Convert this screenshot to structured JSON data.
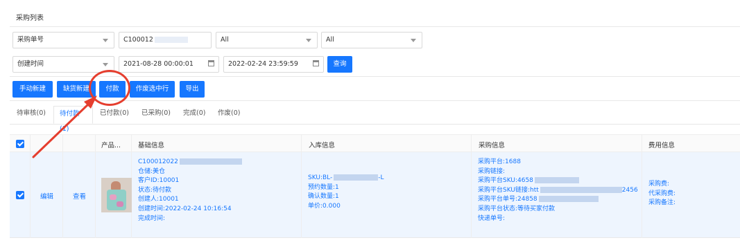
{
  "panel": {
    "title": "采购列表"
  },
  "filters": {
    "row1": {
      "field_select": "采购单号",
      "order_no_value": "C100012",
      "select2": "All",
      "select3": "All"
    },
    "row2": {
      "time_select": "创建时间",
      "start_time": "2021-08-28 00:00:01",
      "end_time": "2022-02-24 23:59:59",
      "query_button": "查询"
    }
  },
  "toolbar": {
    "buttons": [
      "手动新建",
      "缺货新建",
      "付款",
      "作废选中行",
      "导出"
    ]
  },
  "tabs": [
    "待审核(0)",
    "待付款(1)",
    "已付款(0)",
    "已采购(0)",
    "完成(0)",
    "作废(0)"
  ],
  "active_tab": 1,
  "table": {
    "headers": {
      "product": "产品...",
      "basic": "基础信息",
      "inbound": "入库信息",
      "purchase": "采购信息",
      "fee": "费用信息"
    },
    "row": {
      "actions": {
        "edit": "编辑",
        "view": "查看"
      },
      "basic": {
        "order_no": "C100012022",
        "warehouse": "仓储:美仓",
        "customer_id": "客户ID:10001",
        "status": "状态:待付款",
        "creator": "创建人:10001",
        "created_time": "创建时间:2022-02-24 10:16:54",
        "completed_time": "完成时间:"
      },
      "inbound": {
        "sku": "SKU:BL-",
        "sku_tail": "-L",
        "booked_qty": "预约数量:1",
        "confirmed_qty": "确认数量:1",
        "unit_price": "单价:0.000"
      },
      "purchase": {
        "platform": "采购平台:1688",
        "link": "采购链接:",
        "platform_sku": "采购平台SKU:4658",
        "sku_link": "采购平台SKU链接:htt",
        "sku_link_tail": "2456",
        "platform_order": "采购平台单号:24858",
        "platform_status": "采购平台状态:等待买家付款",
        "tracking_no": "快递单号:"
      },
      "fee": {
        "purchase_fee": "采购费:",
        "proxy_fee": "代采购费:",
        "remark": "采购备注:"
      }
    }
  },
  "colors": {
    "primary": "#1677ff",
    "annotation": "#e53e2e",
    "row_selected": "#eef5fe"
  }
}
